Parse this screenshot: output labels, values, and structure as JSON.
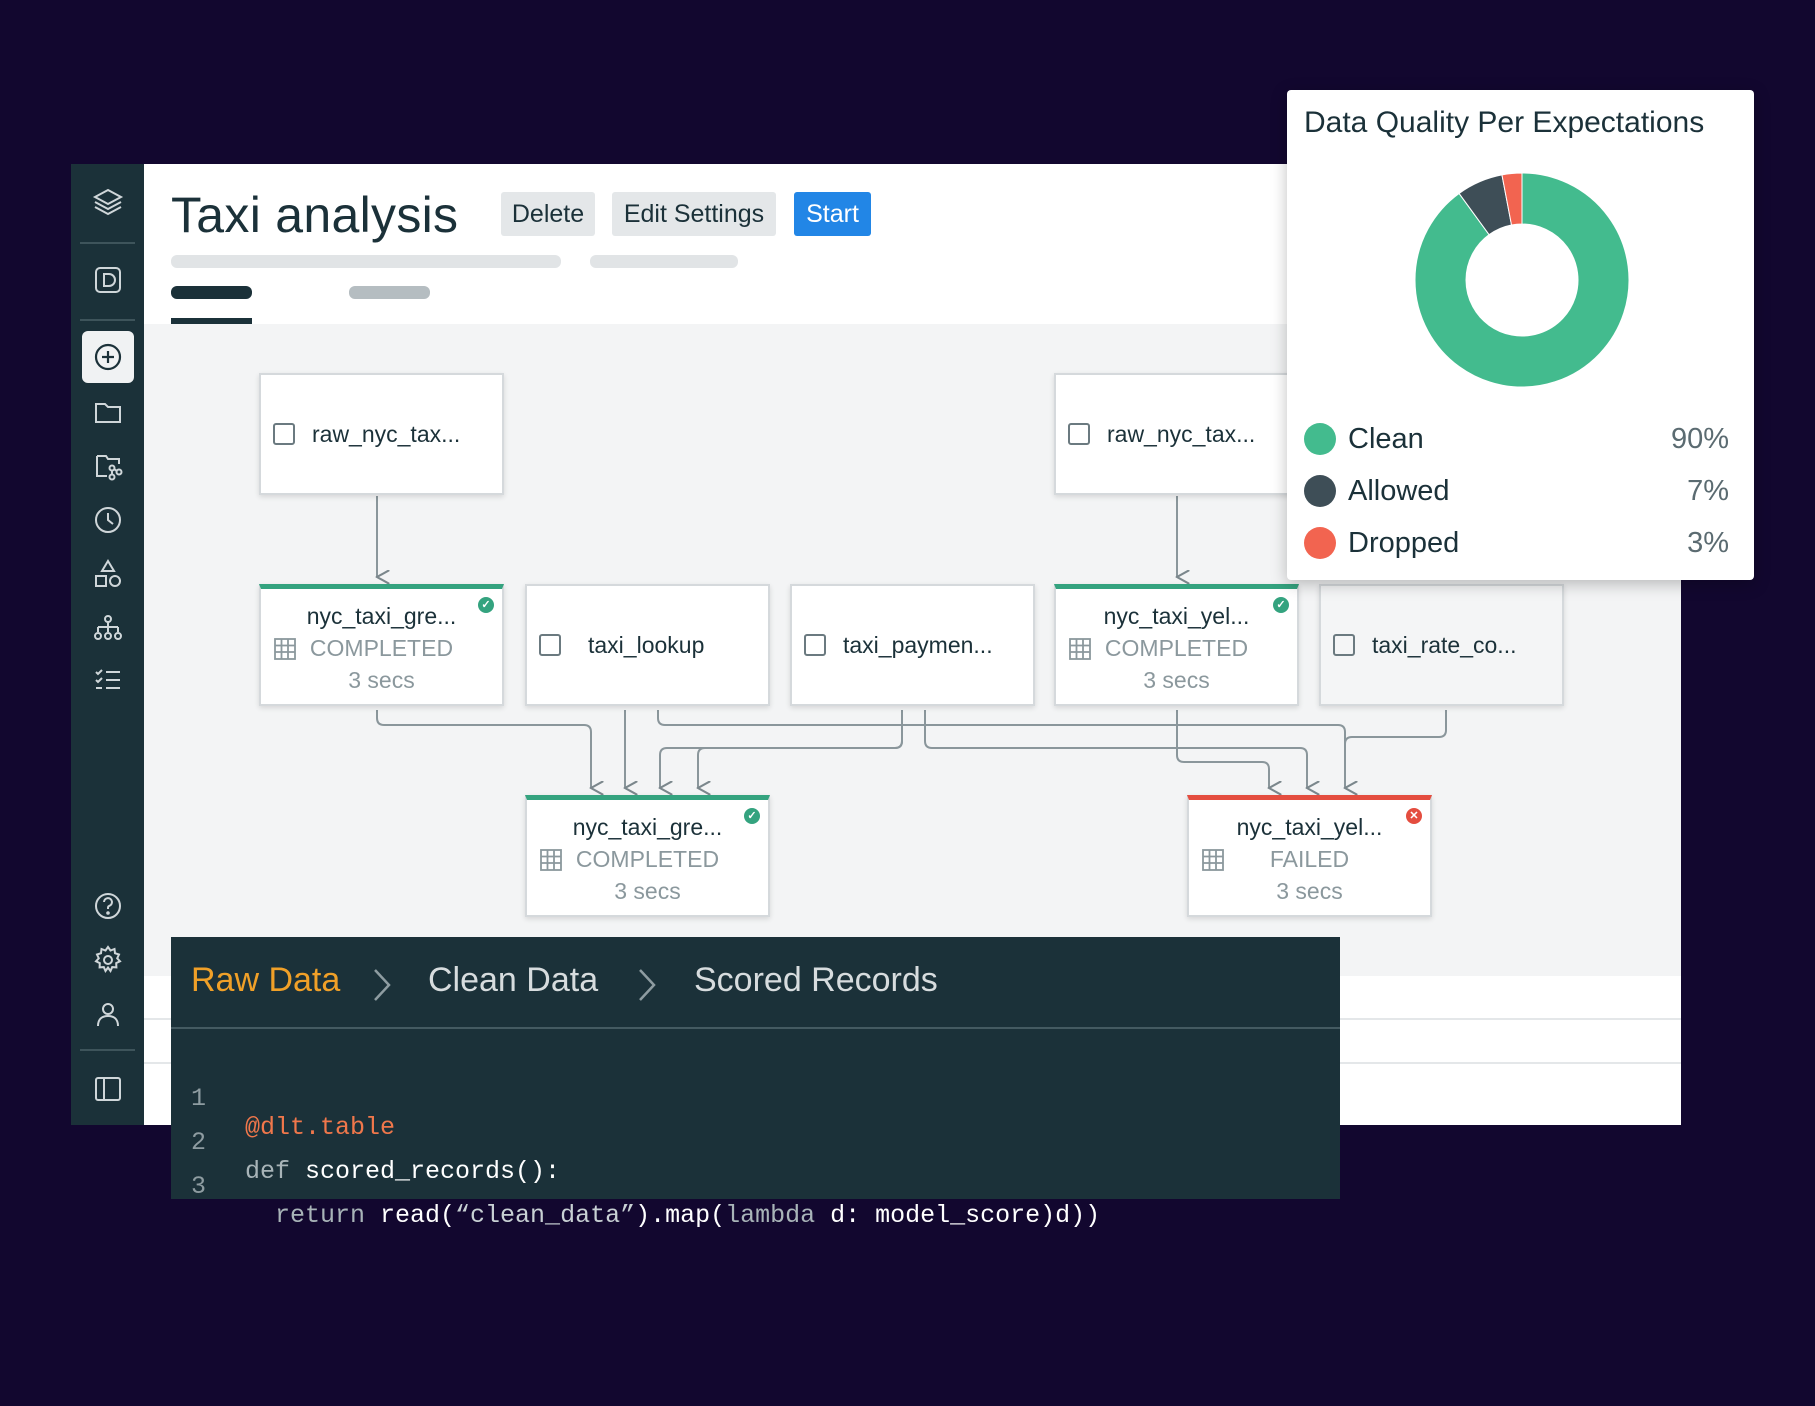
{
  "app": {
    "title": "Taxi analysis",
    "buttons": {
      "delete": "Delete",
      "edit_settings": "Edit Settings",
      "start": "Start"
    },
    "sidebar_icons": [
      "layers-icon",
      "workspace-d-icon",
      "create-plus-icon",
      "folder-icon",
      "repo-branch-icon",
      "clock-icon",
      "shapes-icon",
      "org-tree-icon",
      "checklist-icon",
      "help-icon",
      "gear-icon",
      "user-icon",
      "panel-toggle-icon"
    ]
  },
  "graph": {
    "nodes": {
      "raw_left": {
        "label": "raw_nyc_tax..."
      },
      "raw_right": {
        "label": "raw_nyc_tax..."
      },
      "green_top": {
        "name": "nyc_taxi_gre...",
        "status": "COMPLETED",
        "time": "3 secs"
      },
      "taxi_lookup": {
        "label": "taxi_lookup"
      },
      "taxi_payment": {
        "label": "taxi_paymen..."
      },
      "yellow_top": {
        "name": "nyc_taxi_yel...",
        "status": "COMPLETED",
        "time": "3 secs"
      },
      "taxi_rate": {
        "label": "taxi_rate_co..."
      },
      "green_bottom": {
        "name": "nyc_taxi_gre...",
        "status": "COMPLETED",
        "time": "3 secs"
      },
      "yellow_bottom": {
        "name": "nyc_taxi_yel...",
        "status": "FAILED",
        "time": "3 secs"
      }
    }
  },
  "data_quality": {
    "title": "Data Quality Per Expectations",
    "items": [
      {
        "name": "Clean",
        "value": "90%",
        "percent": 90,
        "color": "#43bb8e"
      },
      {
        "name": "Allowed",
        "value": "7%",
        "percent": 7,
        "color": "#3e4e57"
      },
      {
        "name": "Dropped",
        "value": "3%",
        "percent": 3,
        "color": "#f26450"
      }
    ]
  },
  "code_panel": {
    "breadcrumbs": [
      "Raw Data",
      "Clean Data",
      "Scored Records"
    ],
    "lines": [
      {
        "num": "1",
        "decorator": "@dlt.table"
      },
      {
        "num": "2",
        "kw": "def",
        "rest": " scored_records():"
      },
      {
        "num": "3",
        "kw": "  return",
        "call": " read(",
        "str": "“clean_data”",
        "mid": ").map(",
        "kw2": "lambda",
        "end": " d: model_score)d))"
      }
    ]
  },
  "colors": {
    "background": "#12072f",
    "sidebar": "#1b3139",
    "accent": "#2286e6",
    "success": "#34a37f",
    "error": "#e44d3f",
    "raw_crumb": "#f0a028"
  }
}
